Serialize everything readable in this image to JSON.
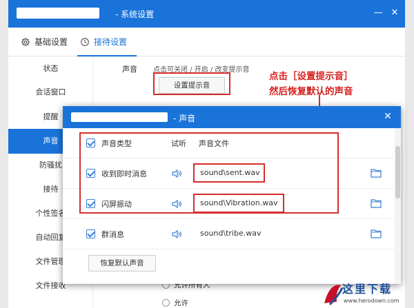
{
  "window": {
    "title": "- 系统设置",
    "minimize": "—",
    "close": "✕"
  },
  "tabs": [
    {
      "label": "基础设置",
      "icon": "gear-icon"
    },
    {
      "label": "接待设置",
      "icon": "clock-icon"
    }
  ],
  "sidebar": {
    "items": [
      "状态",
      "会话窗口",
      "提醒",
      "声音",
      "防骚扰",
      "接待",
      "个性签名",
      "自动回复",
      "文件管理",
      "文件接收"
    ],
    "active": "声音"
  },
  "sound_section": {
    "label": "声音",
    "hint": "点击可关闭 / 开启 / 改变提示音",
    "button": "设置提示音"
  },
  "annotation": {
    "line1": "点击［设置提示音］",
    "line2": "然后恢复默认的声音"
  },
  "background_options": [
    "允许所有人",
    "允许"
  ],
  "dialog": {
    "title": "- 声音",
    "close": "✕",
    "header": {
      "type": "声音类型",
      "preview": "试听",
      "file": "声音文件"
    },
    "rows": [
      {
        "type": "收到即时消息",
        "file": "sound\\sent.wav"
      },
      {
        "type": "闪屏振动",
        "file": "sound\\Vibration.wav"
      },
      {
        "type": "群消息",
        "file": "sound\\tribe.wav"
      }
    ],
    "restore_button": "恢复默认声音"
  },
  "watermark": {
    "text": "这里下载",
    "url": "www.herodown.com"
  },
  "colors": {
    "accent": "#1a73d9",
    "annotation_red": "#d62b2b"
  }
}
